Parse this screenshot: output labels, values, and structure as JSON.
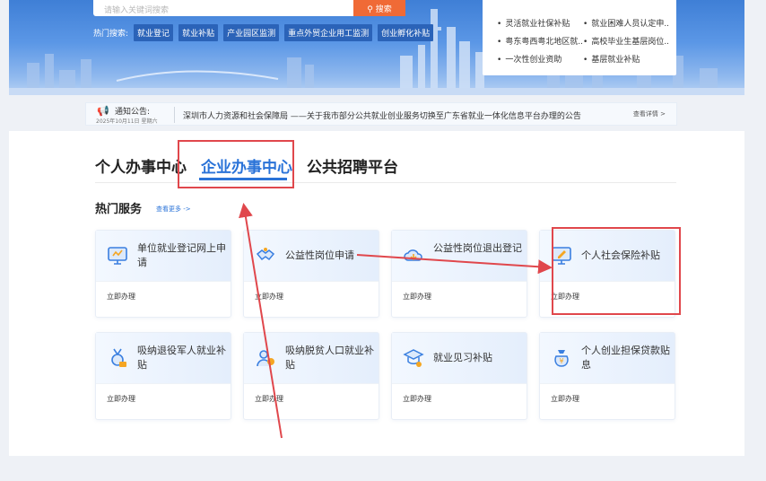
{
  "search": {
    "placeholder": "请输入关键词搜索",
    "button_label": "搜索"
  },
  "hot_search": {
    "label": "热门搜索:",
    "tags": [
      "就业登记",
      "就业补贴",
      "产业园区监测",
      "重点外贸企业用工监测",
      "创业孵化补贴"
    ]
  },
  "news": [
    "灵活就业社保补贴",
    "就业困难人员认定申...",
    "粤东粤西粤北地区就...",
    "高校毕业生基层岗位...",
    "一次性创业资助",
    "基层就业补贴"
  ],
  "notice": {
    "label": "通知公告:",
    "date": "2025年10月11日  星期六",
    "text": "深圳市人力资源和社会保障局 ——关于我市部分公共就业创业服务切换至广东省就业一体化信息平台办理的公告",
    "more": "查看详情 >"
  },
  "tabs": [
    "个人办事中心",
    "企业办事中心",
    "公共招聘平台"
  ],
  "active_tab": "企业办事中心",
  "section": {
    "title": "热门服务",
    "more": "查看更多 ->"
  },
  "services": [
    {
      "title": "单位就业登记网上申请",
      "action": "立即办理",
      "icon": "monitor-icon"
    },
    {
      "title": "公益性岗位申请",
      "action": "立即办理",
      "icon": "handshake-icon"
    },
    {
      "title": "公益性岗位退出登记",
      "action": "立即办理",
      "icon": "cloud-exit-icon"
    },
    {
      "title": "个人社会保险补贴",
      "action": "立即办理",
      "icon": "monitor-edit-icon"
    },
    {
      "title": "吸纳退役军人就业补贴",
      "action": "立即办理",
      "icon": "medal-icon"
    },
    {
      "title": "吸纳脱贫人口就业补贴",
      "action": "立即办理",
      "icon": "person-coin-icon"
    },
    {
      "title": "就业见习补贴",
      "action": "立即办理",
      "icon": "trainee-icon"
    },
    {
      "title": "个人创业担保贷款贴息",
      "action": "立即办理",
      "icon": "money-bag-icon"
    }
  ],
  "colors": {
    "accent": "#2a73d8",
    "annotation": "#e0474c",
    "search_button": "#f06a36"
  }
}
